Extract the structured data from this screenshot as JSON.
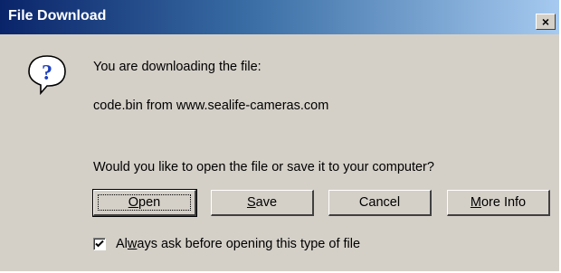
{
  "window": {
    "title": "File Download",
    "close_label": "×"
  },
  "icons": {
    "dialog_icon": "question-icon",
    "close": "close-icon",
    "check": "checkmark-icon"
  },
  "message": {
    "line1": "You are downloading the file:",
    "line2": "code.bin from www.sealife-cameras.com",
    "question": "Would you like to open the file or save it to your computer?"
  },
  "buttons": {
    "open": {
      "mnemonic": "O",
      "rest": "pen"
    },
    "save": {
      "mnemonic": "S",
      "rest": "ave"
    },
    "cancel": "Cancel",
    "more_info": {
      "mnemonic": "M",
      "rest": "ore Info"
    }
  },
  "checkbox": {
    "checked": true,
    "label_pre": "Al",
    "label_mnemonic": "w",
    "label_post": "ays ask before opening this type of file"
  },
  "colors": {
    "title_gradient_start": "#0a246a",
    "title_gradient_end": "#a6caf0",
    "dialog_face": "#d4d0c8",
    "icon_blue": "#1e3fbf"
  }
}
